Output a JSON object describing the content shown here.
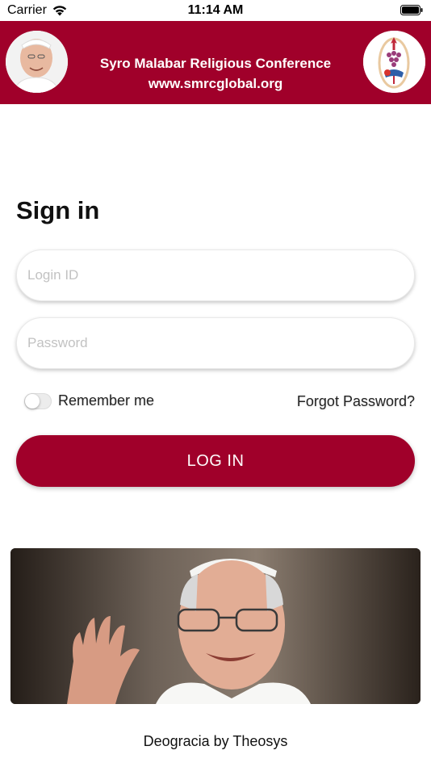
{
  "status_bar": {
    "carrier": "Carrier",
    "time": "11:14 AM",
    "icons": [
      "wifi-icon",
      "battery-icon"
    ]
  },
  "header": {
    "title": "Syro Malabar Religious Conference",
    "website": "www.smrcglobal.org",
    "background_color": "#a0002a",
    "left_image": "pope-portrait",
    "right_image": "conference-logo"
  },
  "signin": {
    "title": "Sign in",
    "login_id": {
      "value": "",
      "placeholder": "Login ID"
    },
    "password": {
      "value": "",
      "placeholder": "Password"
    },
    "remember_me_label": "Remember me",
    "remember_me_on": false,
    "forgot_password_label": "Forgot Password?",
    "login_button_label": "LOG IN",
    "accent_color": "#a0002a"
  },
  "banner": {
    "image": "pope-waving-photo"
  },
  "footer": {
    "text": "Deogracia by Theosys"
  }
}
